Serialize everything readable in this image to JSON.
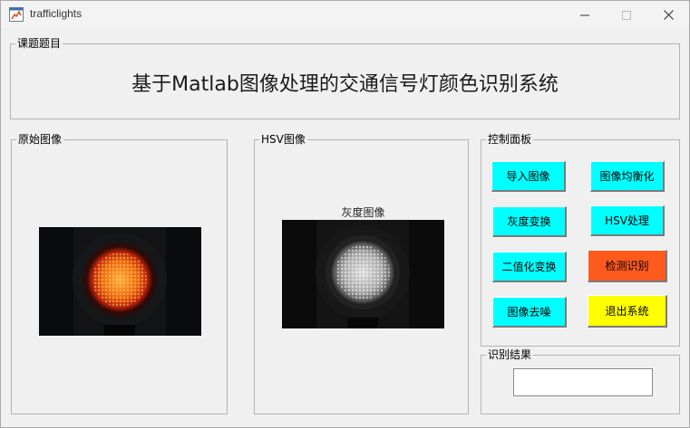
{
  "window": {
    "title": "trafficlights",
    "controls": {
      "minimize": "minimize-icon",
      "maximize": "maximize-icon",
      "close": "close-icon"
    }
  },
  "title_panel": {
    "label": "课题题目",
    "heading": "基于Matlab图像处理的交通信号灯颜色识别系统"
  },
  "original_panel": {
    "label": "原始图像"
  },
  "hsv_panel": {
    "label": "HSV图像",
    "image_caption": "灰度图像"
  },
  "control_panel": {
    "label": "控制面板",
    "buttons": [
      {
        "label": "导入图像",
        "color": "#00ffff"
      },
      {
        "label": "图像均衡化",
        "color": "#00ffff"
      },
      {
        "label": "灰度变换",
        "color": "#00ffff"
      },
      {
        "label": "HSV处理",
        "color": "#00ffff"
      },
      {
        "label": "二值化变换",
        "color": "#00ffff"
      },
      {
        "label": "检测识别",
        "color": "#ff5a1e"
      },
      {
        "label": "图像去噪",
        "color": "#00ffff"
      },
      {
        "label": "退出系统",
        "color": "#ffff00"
      }
    ]
  },
  "result_panel": {
    "label": "识别结果",
    "value": ""
  }
}
